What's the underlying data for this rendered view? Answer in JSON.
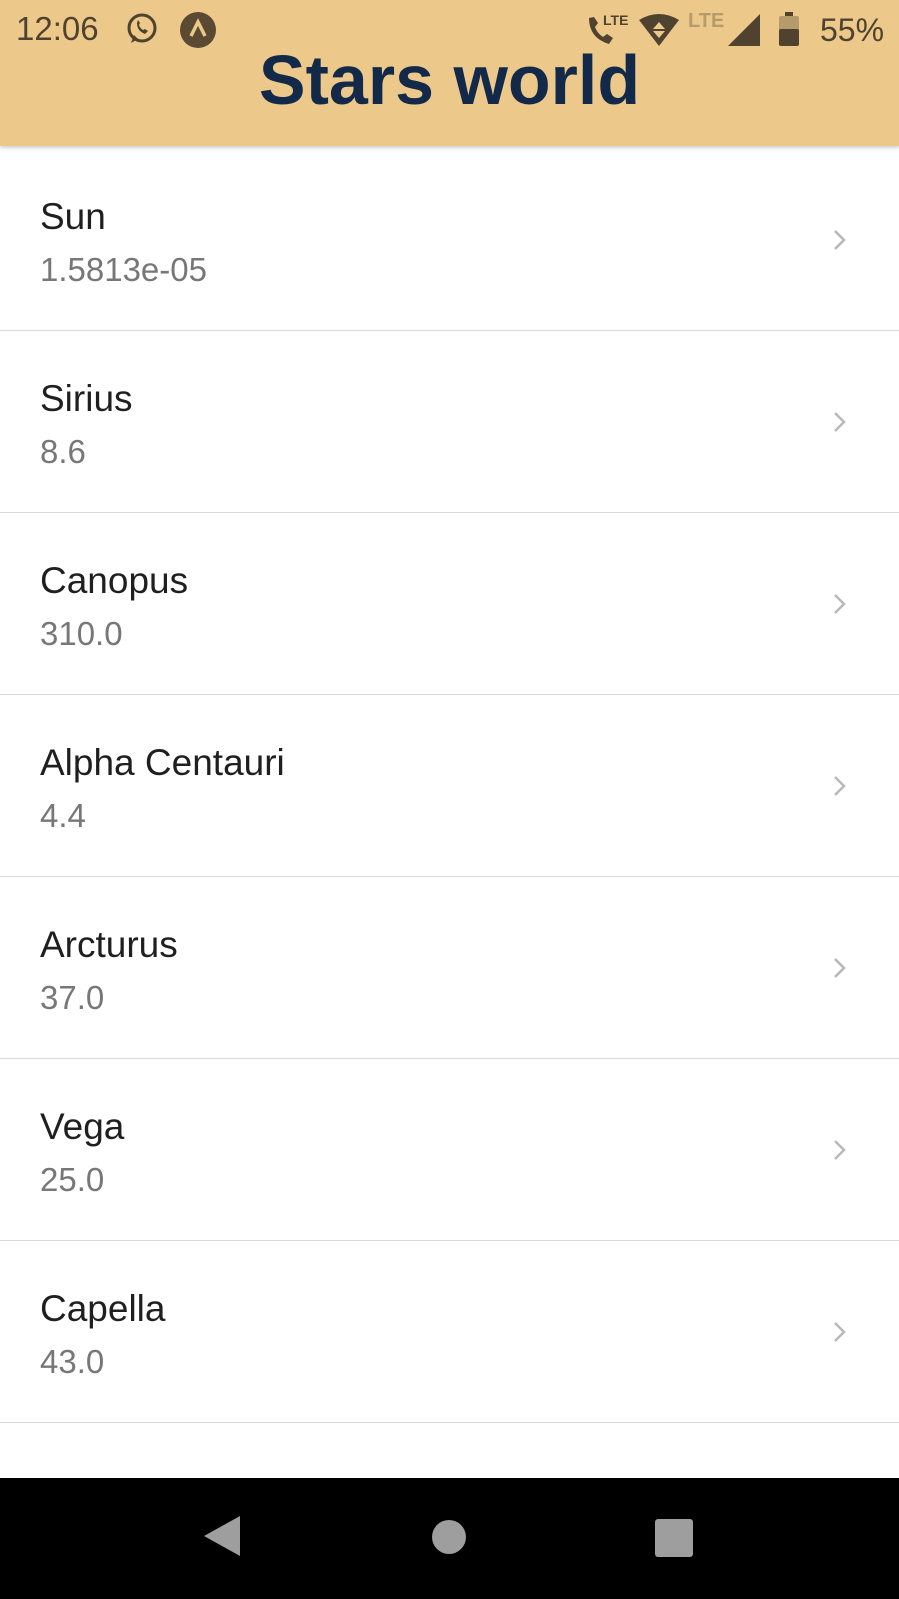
{
  "status_bar": {
    "time": "12:06",
    "lte_call_label": "LTE",
    "network_label": "LTE",
    "battery_percent": "55%",
    "icons": [
      "whatsapp-icon",
      "app-icon",
      "lte-call-icon",
      "wifi-icon",
      "signal-icon",
      "battery-icon"
    ]
  },
  "header": {
    "title": "Stars world",
    "background_color": "#ecc98a",
    "title_color": "#13294a"
  },
  "stars": [
    {
      "name": "Sun",
      "value": "1.5813e-05"
    },
    {
      "name": "Sirius",
      "value": "8.6"
    },
    {
      "name": "Canopus",
      "value": "310.0"
    },
    {
      "name": "Alpha Centauri",
      "value": "4.4"
    },
    {
      "name": "Arcturus",
      "value": "37.0"
    },
    {
      "name": "Vega",
      "value": "25.0"
    },
    {
      "name": "Capella",
      "value": "43.0"
    }
  ],
  "nav_bar": {
    "buttons": [
      "back-icon",
      "home-icon",
      "recents-icon"
    ]
  }
}
